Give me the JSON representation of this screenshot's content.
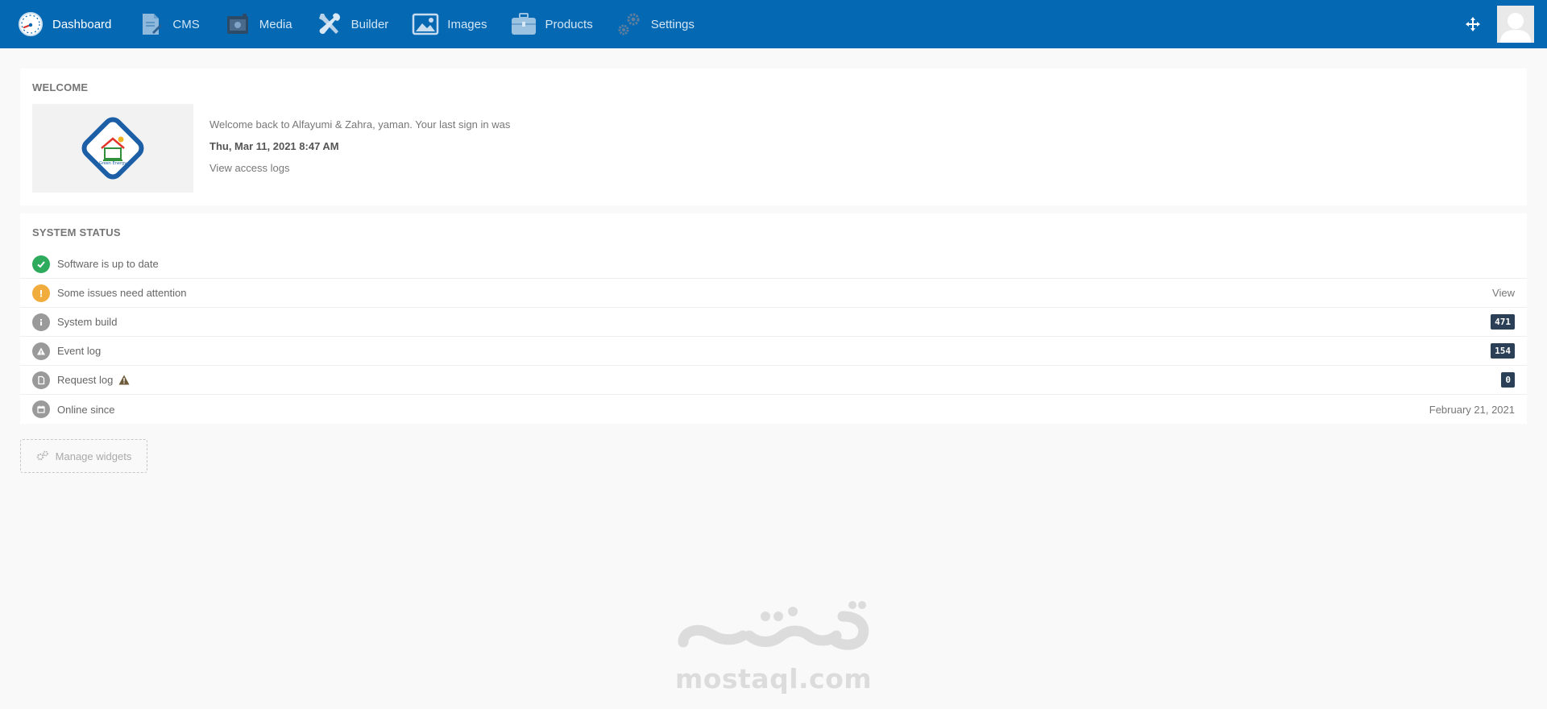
{
  "nav": {
    "items": [
      {
        "label": "Dashboard",
        "icon": "dashboard-gauge-icon",
        "active": true
      },
      {
        "label": "CMS",
        "icon": "cms-document-icon",
        "active": false
      },
      {
        "label": "Media",
        "icon": "media-folder-icon",
        "active": false
      },
      {
        "label": "Builder",
        "icon": "builder-tools-icon",
        "active": false
      },
      {
        "label": "Images",
        "icon": "image-icon",
        "active": false
      },
      {
        "label": "Products",
        "icon": "briefcase-icon",
        "active": false
      },
      {
        "label": "Settings",
        "icon": "gears-icon",
        "active": false
      }
    ],
    "right": {
      "locate_icon": "crosshair-icon",
      "avatar_icon": "user-avatar-icon"
    }
  },
  "welcome": {
    "title": "WELCOME",
    "line": "Welcome back to Alfayumi & Zahra, yaman. Your last sign in was",
    "date": "Thu, Mar 11, 2021 8:47 AM",
    "link": "View access logs",
    "logo_caption": "Green Energy"
  },
  "status": {
    "title": "SYSTEM STATUS",
    "rows": [
      {
        "label": "Software is up to date",
        "icon": "check-circle-icon",
        "color": "#2eaa5c",
        "right": ""
      },
      {
        "label": "Some issues need attention",
        "icon": "exclamation-circle-icon",
        "color": "#f0ad3e",
        "right": "View"
      },
      {
        "label": "System build",
        "icon": "info-circle-icon",
        "color": "#9a9a9a",
        "badge": "471"
      },
      {
        "label": "Event log",
        "icon": "warning-circle-icon",
        "color": "#9a9a9a",
        "badge": "154"
      },
      {
        "label": "Request log",
        "icon": "file-circle-icon",
        "color": "#9a9a9a",
        "badge": "0",
        "warning": true
      },
      {
        "label": "Online since",
        "icon": "calendar-circle-icon",
        "color": "#9a9a9a",
        "right": "February 21, 2021"
      }
    ]
  },
  "manage_widgets": {
    "label": "Manage widgets",
    "icon": "cogs-icon"
  },
  "watermark": {
    "text": "mostaql.com",
    "arabic_logo": "مستقل"
  },
  "colors": {
    "nav_bg": "#0468b3",
    "success": "#2eaa5c",
    "warning": "#f0ad3e",
    "badge_bg": "#2b4056",
    "page_bg": "#f9f9f9"
  }
}
